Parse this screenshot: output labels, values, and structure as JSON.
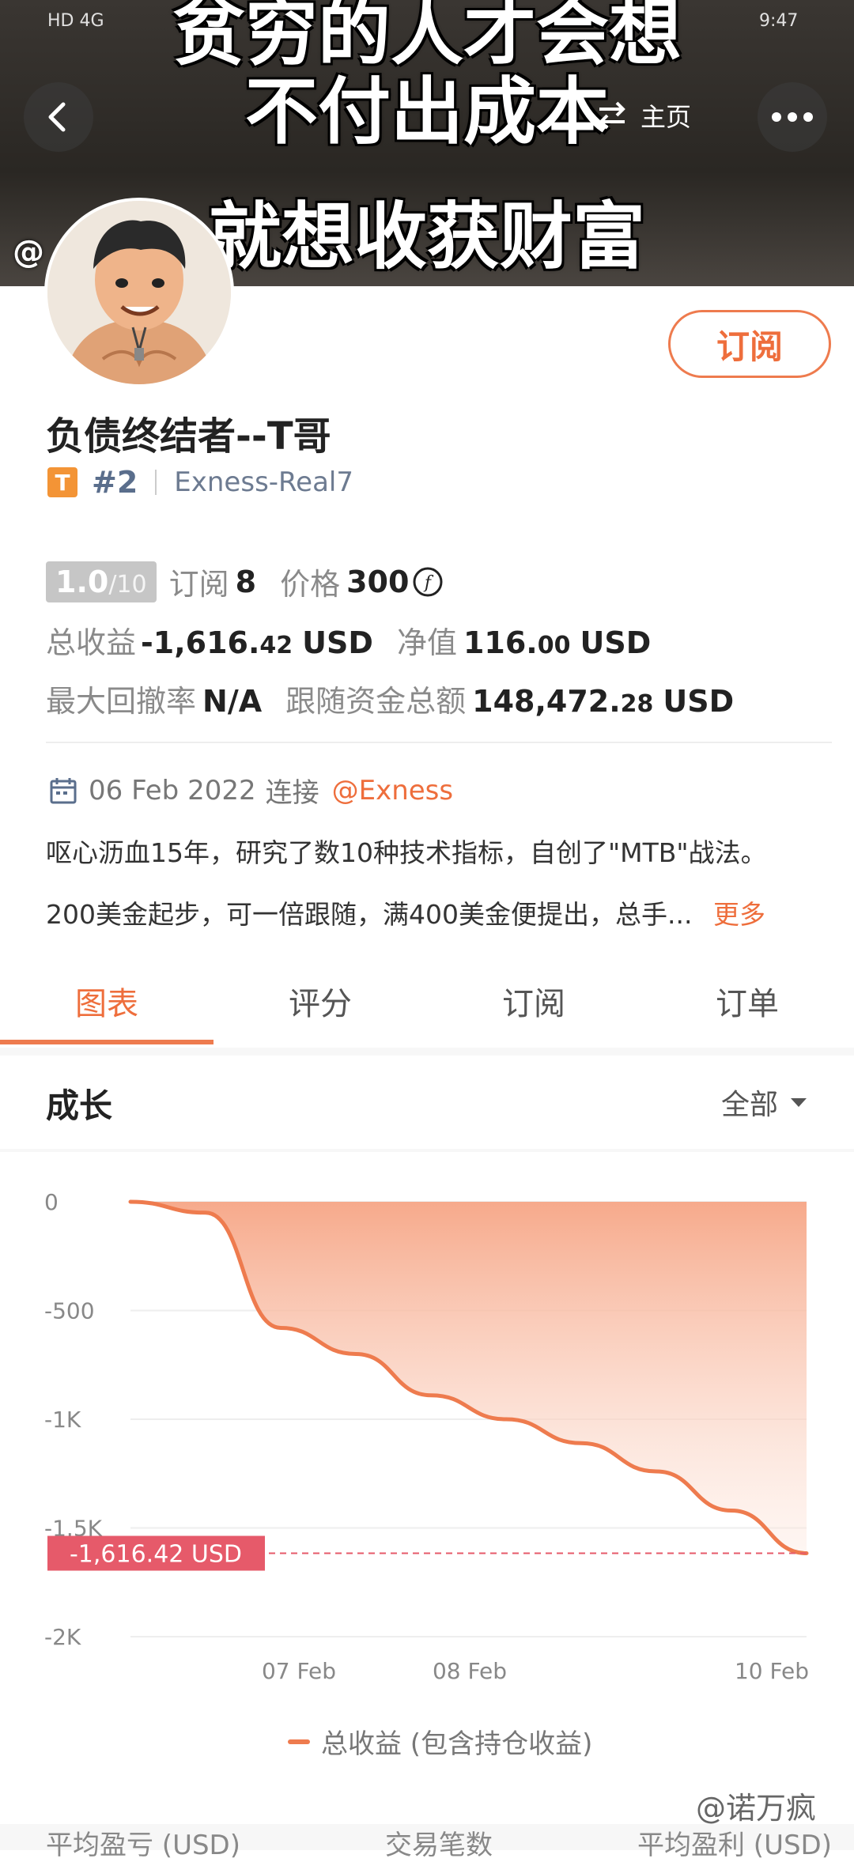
{
  "banner": {
    "lines": [
      "贫穷的人才会想",
      "不付出成本",
      "就想收获财富"
    ],
    "watermark": "@",
    "status_left": "HD 4G",
    "status_right": "9:47"
  },
  "nav": {
    "back_icon": "back-arrow-icon",
    "home_label": "主页",
    "home_icon": "swap-icon",
    "more_icon": "more-dots-icon"
  },
  "profile": {
    "name": "负债终结者--T哥",
    "badge": "T",
    "rank": "#2",
    "server": "Exness-Real7",
    "subscribe_label": "订阅"
  },
  "stats": {
    "rating_num": "1.0",
    "rating_den": "/10",
    "subs_label": "订阅",
    "subs_value": "8",
    "price_label": "价格",
    "price_value": "300",
    "price_icon": "fcoin-icon",
    "profit_label": "总收益",
    "profit_int": "-1,616.",
    "profit_dec": "42",
    "profit_unit": "USD",
    "equity_label": "净值",
    "equity_int": "116.",
    "equity_dec": "00",
    "equity_unit": "USD",
    "drawdown_label": "最大回撤率",
    "drawdown_value": "N/A",
    "follow_label": "跟随资金总额",
    "follow_int": "148,472.",
    "follow_dec": "28",
    "follow_unit": "USD"
  },
  "connect": {
    "date": "06 Feb 2022",
    "label": "连接",
    "broker": "@Exness"
  },
  "description": {
    "line1": "呕心沥血15年，研究了数10种技术指标，自创了\"MTB\"战法。",
    "line2": "200美金起步，可一倍跟随，满400美金便提出，总手...",
    "more": "更多"
  },
  "tabs": [
    {
      "label": "图表",
      "active": true
    },
    {
      "label": "评分",
      "active": false
    },
    {
      "label": "订阅",
      "active": false
    },
    {
      "label": "订单",
      "active": false
    }
  ],
  "growth": {
    "title": "成长",
    "filter": "全部"
  },
  "chart_data": {
    "type": "area",
    "y_ticks": [
      "0",
      "-500",
      "-1K",
      "-1.5K",
      "-2K"
    ],
    "ylim": [
      -2000,
      0
    ],
    "x_ticks": [
      "07 Feb",
      "08 Feb",
      "10 Feb"
    ],
    "x": [
      "06 Feb",
      "06 Feb",
      "07 Feb",
      "07 Feb",
      "08 Feb",
      "08 Feb",
      "09 Feb",
      "09 Feb",
      "10 Feb",
      "10 Feb"
    ],
    "values": [
      0,
      -50,
      -580,
      -700,
      -890,
      -1000,
      -1110,
      -1240,
      -1420,
      -1616.42
    ],
    "last_value_label": "-1,616.42 USD",
    "series": [
      {
        "name": "总收益 (包含持仓收益)"
      }
    ],
    "legend": "bottom",
    "colors": {
      "line": "#ee7b4e",
      "fill_top": "#f6a585",
      "label_bg": "#e65a6a"
    }
  },
  "legend_label": "总收益 (包含持仓收益)",
  "bottom_labels": [
    "平均盈亏 (USD)",
    "交易笔数",
    "平均盈利 (USD)"
  ],
  "watermark_bottom": "@诺万疯"
}
